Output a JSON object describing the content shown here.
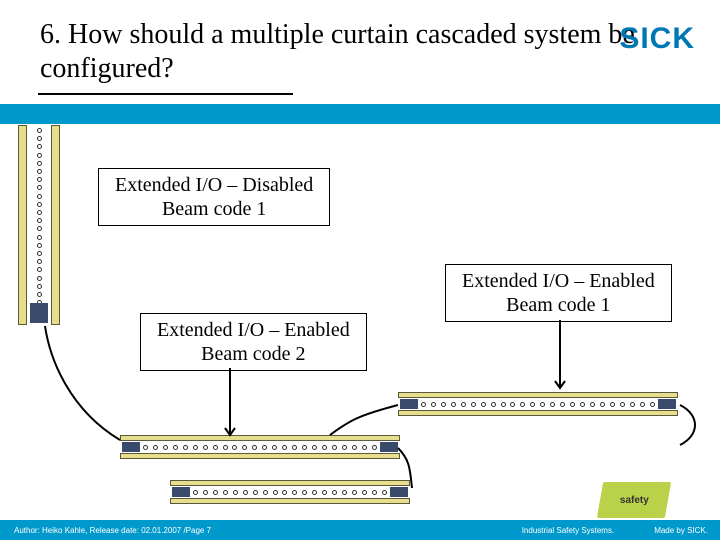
{
  "title": "6. How should a multiple curtain cascaded system be configured?",
  "logo": "SICK",
  "labels": {
    "box1": {
      "l1": "Extended I/O – Disabled",
      "l2": "Beam code 1"
    },
    "box2": {
      "l1": "Extended I/O – Enabled",
      "l2": "Beam code 1"
    },
    "box3": {
      "l1": "Extended I/O – Enabled",
      "l2": "Beam code 2"
    }
  },
  "footer": {
    "left": "Author: Heiko Kahle, Release date: 02.01.2007 /Page 7",
    "mid": "Industrial Safety Systems.",
    "right": "Made by SICK."
  },
  "safety": "safety"
}
